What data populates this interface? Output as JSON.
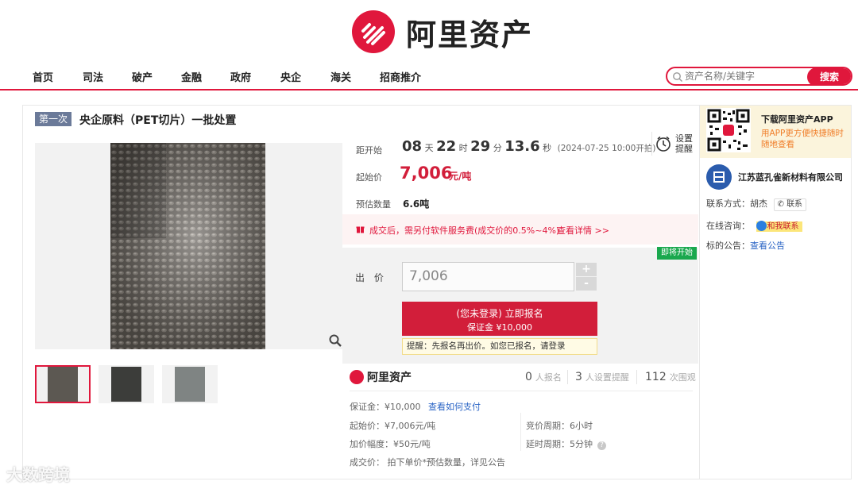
{
  "header": {
    "brand": "阿里资产",
    "nav": [
      "首页",
      "司法",
      "破产",
      "金融",
      "政府",
      "央企",
      "海关",
      "招商推介"
    ],
    "search": {
      "placeholder": "资产名称/关键字",
      "button": "搜索"
    }
  },
  "item": {
    "round_badge": "第一次",
    "title": "央企原料（PET切片）一批处置",
    "countdown": {
      "label": "距开始",
      "days": "08",
      "days_unit": "天",
      "hours": "22",
      "hours_unit": "时",
      "minutes": "29",
      "minutes_unit": "分",
      "seconds": "13.6",
      "seconds_unit": "秒",
      "start_note": "(2024-07-25 10:00开拍)"
    },
    "reminder": {
      "label": "设置提醒"
    },
    "start_price": {
      "label": "起始价",
      "value": "7,006",
      "unit": "元/吨"
    },
    "quantity": {
      "label": "预估数量",
      "value": "6.6吨"
    },
    "fee_notice": {
      "text": "成交后，需另付软件服务费(成交价的0.5%~4%)",
      "link": "查看详情 >>"
    },
    "bid": {
      "status_tag": "即将开始",
      "label": "出 价",
      "value": "7,006",
      "plus": "+",
      "minus": "-",
      "signup_line1": "(您未登录) 立即报名",
      "signup_line2": "保证金 ¥10,000",
      "hint": "提醒：先报名再出价。如您已报名，请登录"
    },
    "stats": {
      "brand": "阿里资产",
      "signups": "0",
      "signups_label": "人报名",
      "reminders": "3",
      "reminders_label": "人设置提醒",
      "views": "112",
      "views_label": "次围观"
    },
    "details": {
      "deposit": "保证金：¥10,000",
      "deposit_link": "查看如何支付",
      "start_price": "起始价：¥7,006元/吨",
      "increment": "加价幅度：¥50元/吨",
      "deal_price": "成交价：  拍下单价*预估数量，详见公告",
      "cycle": "竞价周期：6小时",
      "delay": "延时周期：5分钟"
    }
  },
  "sidebar": {
    "app_title": "下载阿里资产APP",
    "app_sub": "用APP更方便快捷随时随地查看",
    "company": "江苏蓝孔雀新材料有限公司",
    "contact_label": "联系方式：胡杰",
    "contact_btn": "联系",
    "online_label": "在线咨询：",
    "online_btn": "和我联系",
    "notice_label": "标的公告：",
    "notice_link": "查看公告"
  },
  "watermark": "大数跨境",
  "colors": {
    "brand_red": "#e0173c",
    "price_red": "#d21e3a",
    "green_tag": "#1aa84e",
    "link_blue": "#2a64c5"
  }
}
